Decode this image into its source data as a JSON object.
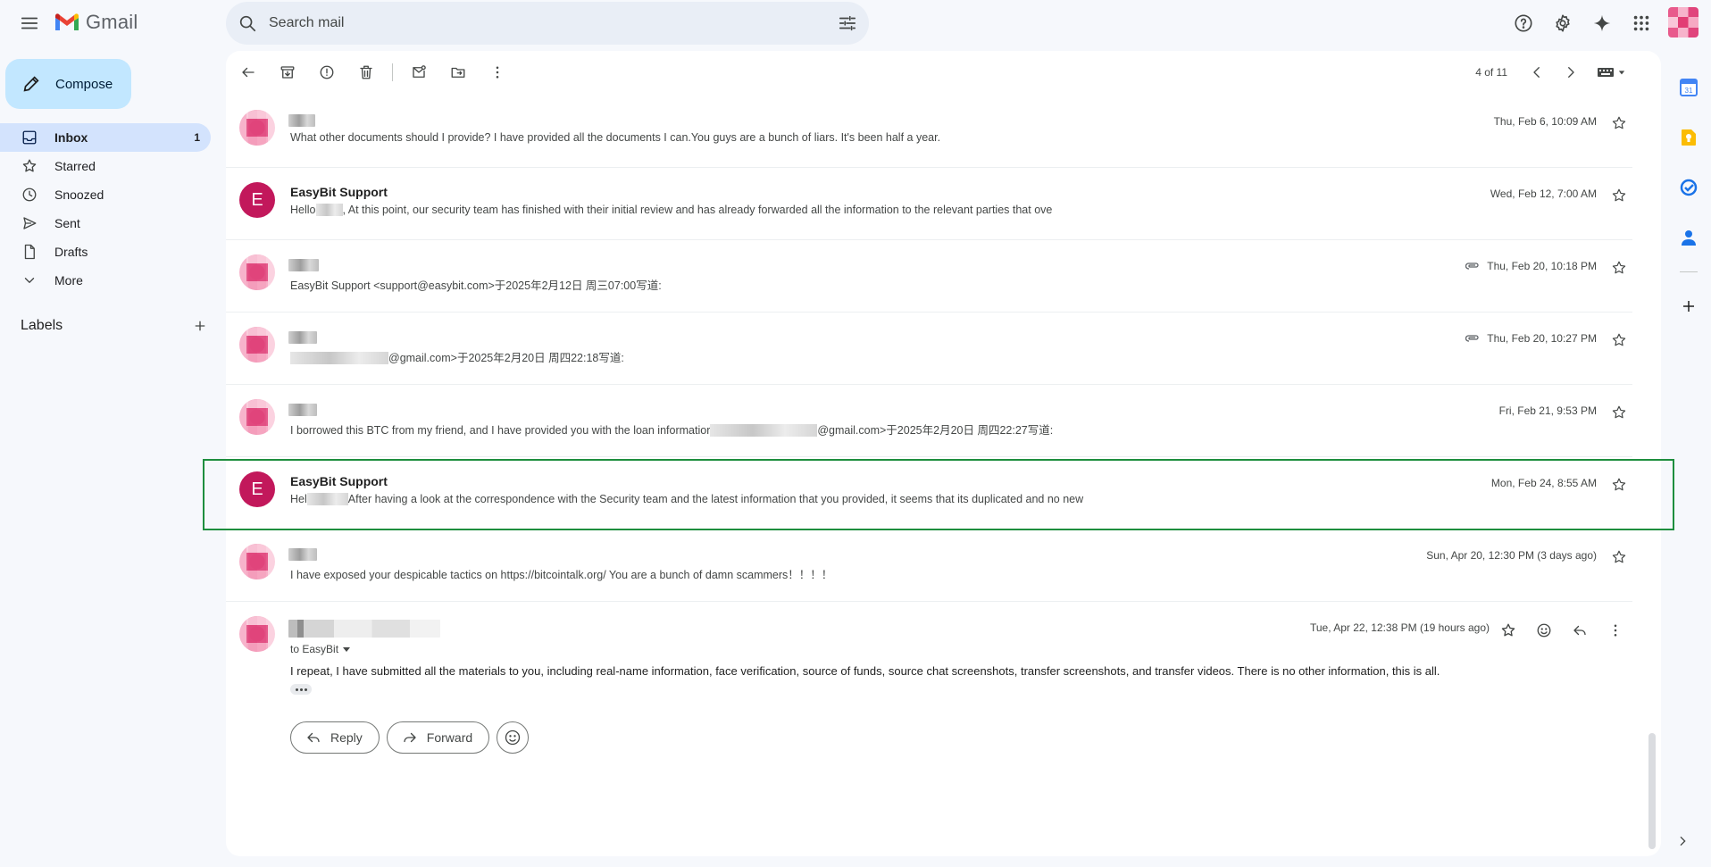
{
  "app": {
    "name": "Gmail"
  },
  "search": {
    "placeholder": "Search mail"
  },
  "compose": {
    "label": "Compose"
  },
  "nav": [
    {
      "id": "inbox",
      "label": "Inbox",
      "count": "1",
      "icon": "inbox-icon",
      "active": true
    },
    {
      "id": "starred",
      "label": "Starred",
      "count": "",
      "icon": "star-icon"
    },
    {
      "id": "snoozed",
      "label": "Snoozed",
      "count": "",
      "icon": "clock-icon"
    },
    {
      "id": "sent",
      "label": "Sent",
      "count": "",
      "icon": "send-icon"
    },
    {
      "id": "drafts",
      "label": "Drafts",
      "count": "",
      "icon": "draft-icon"
    },
    {
      "id": "more",
      "label": "More",
      "count": "",
      "icon": "chevron-down-icon"
    }
  ],
  "labels": {
    "title": "Labels"
  },
  "toolbar": {
    "pager": "4 of 11"
  },
  "thread": [
    {
      "sender": "",
      "redacted_sender": true,
      "snippet": "What other documents should I provide? I have provided all the documents I can.You guys are a bunch of liars. It's been half a year.",
      "date": "Thu, Feb 6, 10:09 AM",
      "attachment": false
    },
    {
      "sender": "EasyBit Support",
      "avatar_letter": "E",
      "snippet_pre": "Hello",
      "snippet": ", At this point, our security team has finished with their initial review and has already forwarded all the information to the relevant parties that ove",
      "date": "Wed, Feb 12, 7:00 AM",
      "attachment": false
    },
    {
      "sender": "",
      "redacted_sender": true,
      "snippet": "EasyBit Support <support@easybit.com>于2025年2月12日 周三07:00写道:",
      "date": "Thu, Feb 20, 10:18 PM",
      "attachment": true
    },
    {
      "sender": "",
      "redacted_sender": true,
      "snippet": "@gmail.com>于2025年2月20日 周四22:18写道:",
      "date": "Thu, Feb 20, 10:27 PM",
      "attachment": true
    },
    {
      "sender": "",
      "redacted_sender": true,
      "snippet_pre": "I borrowed this BTC from my friend, and I have provided you with the loan informatior",
      "snippet": "@gmail.com>于2025年2月20日 周四22:27写道:",
      "date": "Fri, Feb 21, 9:53 PM",
      "attachment": false
    },
    {
      "sender": "EasyBit Support",
      "avatar_letter": "E",
      "snippet_pre": "Hel",
      "snippet": "After having a look at the correspondence with the Security team and the latest information that you provided, it seems that its duplicated and no new",
      "date": "Mon, Feb 24, 8:55 AM",
      "attachment": false
    },
    {
      "sender": "",
      "redacted_sender": true,
      "snippet": "I have exposed your despicable tactics on https://bitcointalk.org/ You are a bunch of damn scammers！！！！",
      "date": "Sun, Apr 20, 12:30 PM (3 days ago)",
      "attachment": false
    }
  ],
  "expanded": {
    "to": "to EasyBit",
    "date": "Tue, Apr 22, 12:38 PM (19 hours ago)",
    "body": "I repeat, I have submitted all the materials to you, including real-name information, face verification, source of funds, source chat screenshots, transfer screenshots, and transfer videos. There is no other information, this is all.",
    "reply_label": "Reply",
    "forward_label": "Forward"
  },
  "colors": {
    "accent": "#0b57d0",
    "compose_bg": "#c2e7ff",
    "active_nav": "#d3e3fd",
    "highlight": "#1e8e3e",
    "avatar_e": "#c2185b"
  }
}
